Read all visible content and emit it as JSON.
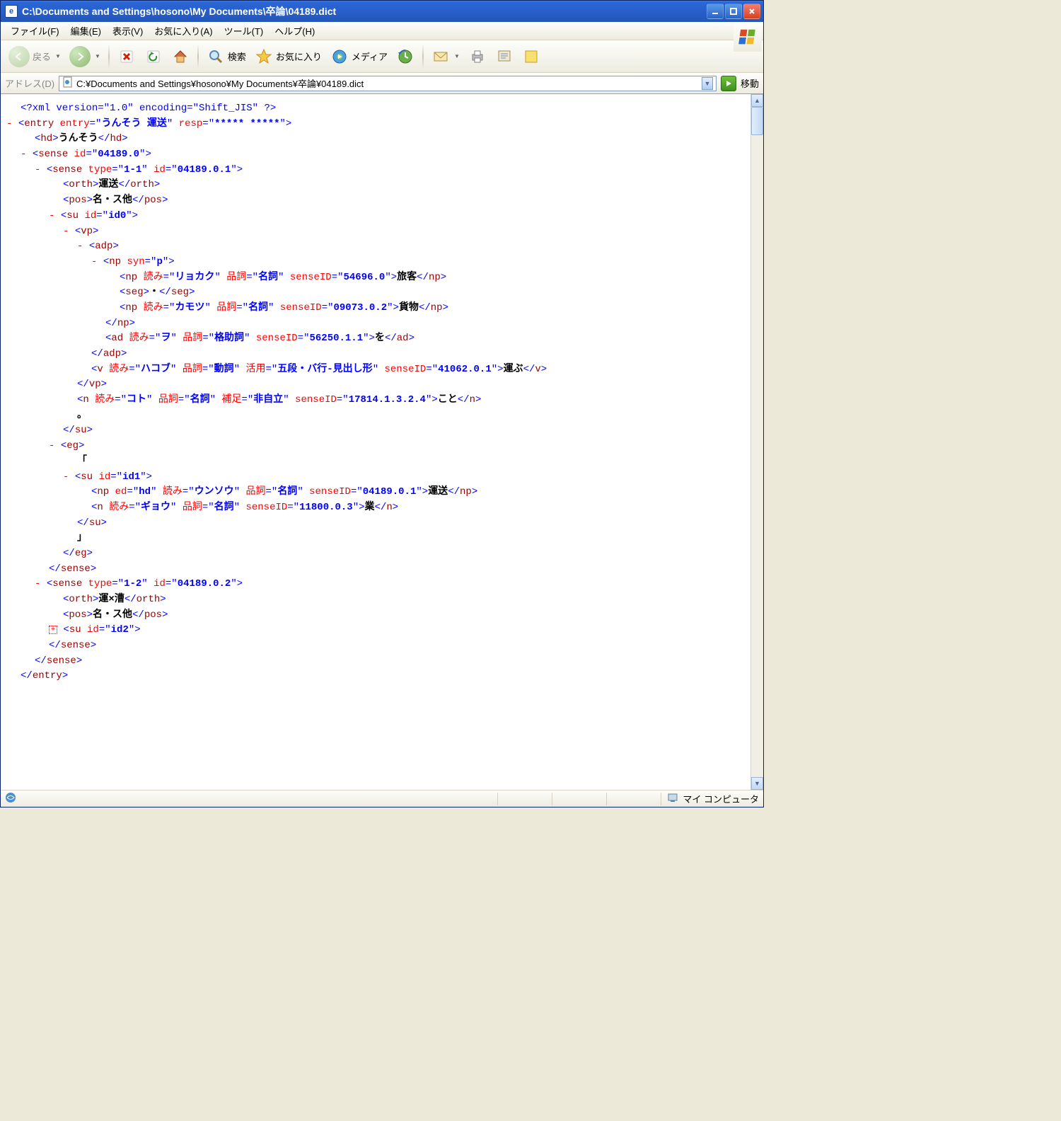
{
  "window": {
    "title": "C:\\Documents and Settings\\hosono\\My Documents\\卒論\\04189.dict"
  },
  "menu": {
    "file": "ファイル(F)",
    "edit": "編集(E)",
    "view": "表示(V)",
    "fav": "お気に入り(A)",
    "tools": "ツール(T)",
    "help": "ヘルプ(H)"
  },
  "toolbar": {
    "back": "戻る",
    "search": "検索",
    "fav": "お気に入り",
    "media": "メディア"
  },
  "address": {
    "label": "アドレス(D)",
    "value": "C:¥Documents and Settings¥hosono¥My Documents¥卒論¥04189.dict",
    "go": "移動"
  },
  "status": {
    "zone": "マイ コンピュータ"
  },
  "xml": {
    "decl": "<?xml version=\"1.0\" encoding=\"Shift_JIS\" ?>",
    "entry_attr_entry": "うんそう 運送",
    "entry_attr_resp": "***** *****",
    "hd": "うんそう",
    "sense0_id": "04189.0",
    "sense01_type": "1-1",
    "sense01_id": "04189.0.1",
    "orth1": "運送",
    "pos1": "名・ス他",
    "su0_id": "id0",
    "np_syn": "p",
    "np1_yomi": "リョカク",
    "np1_hinshi": "名詞",
    "np1_sid": "54696.0",
    "np1_txt": "旅客",
    "seg_txt": "・",
    "np2_yomi": "カモツ",
    "np2_hinshi": "名詞",
    "np2_sid": "09073.0.2",
    "np2_txt": "貨物",
    "ad_yomi": "ヲ",
    "ad_hinshi": "格助詞",
    "ad_sid": "56250.1.1",
    "ad_txt": "を",
    "v_yomi": "ハコブ",
    "v_hinshi": "動詞",
    "v_katsu": "五段・バ行-見出し形",
    "v_sid": "41062.0.1",
    "v_txt": "運ぶ",
    "n_yomi": "コト",
    "n_hinshi": "名詞",
    "n_hosoku": "非自立",
    "n_sid": "17814.1.3.2.4",
    "n_txt": "こと",
    "quote_open": "「",
    "su1_id": "id1",
    "np3_ed": "hd",
    "np3_yomi": "ウンソウ",
    "np3_hinshi": "名詞",
    "np3_sid": "04189.0.1",
    "np3_txt": "運送",
    "n2_yomi": "ギョウ",
    "n2_hinshi": "名詞",
    "n2_sid": "11800.0.3",
    "n2_txt": "業",
    "quote_close": "」",
    "sense02_type": "1-2",
    "sense02_id": "04189.0.2",
    "orth2": "運×漕",
    "pos2": "名・ス他",
    "su2_id": "id2"
  }
}
